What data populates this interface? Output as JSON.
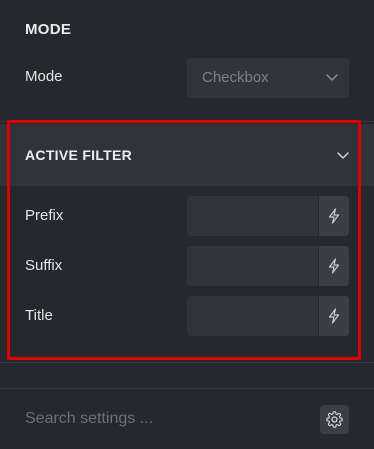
{
  "mode_section": {
    "title": "MODE",
    "mode_label": "Mode",
    "mode_select_value": "Checkbox"
  },
  "active_filter": {
    "title": "ACTIVE FILTER",
    "fields": [
      {
        "label": "Prefix",
        "value": ""
      },
      {
        "label": "Suffix",
        "value": ""
      },
      {
        "label": "Title",
        "value": ""
      }
    ]
  },
  "footer": {
    "search_placeholder": "Search settings ..."
  },
  "icons": {
    "select_chevron": "chevron-down-icon",
    "section_chevron": "chevron-down-icon",
    "dynamic": "lightning-bolt-icon",
    "settings": "gear-icon"
  },
  "colors": {
    "background": "#25282d",
    "header_background": "#30343a",
    "highlight_border": "#e00000"
  }
}
